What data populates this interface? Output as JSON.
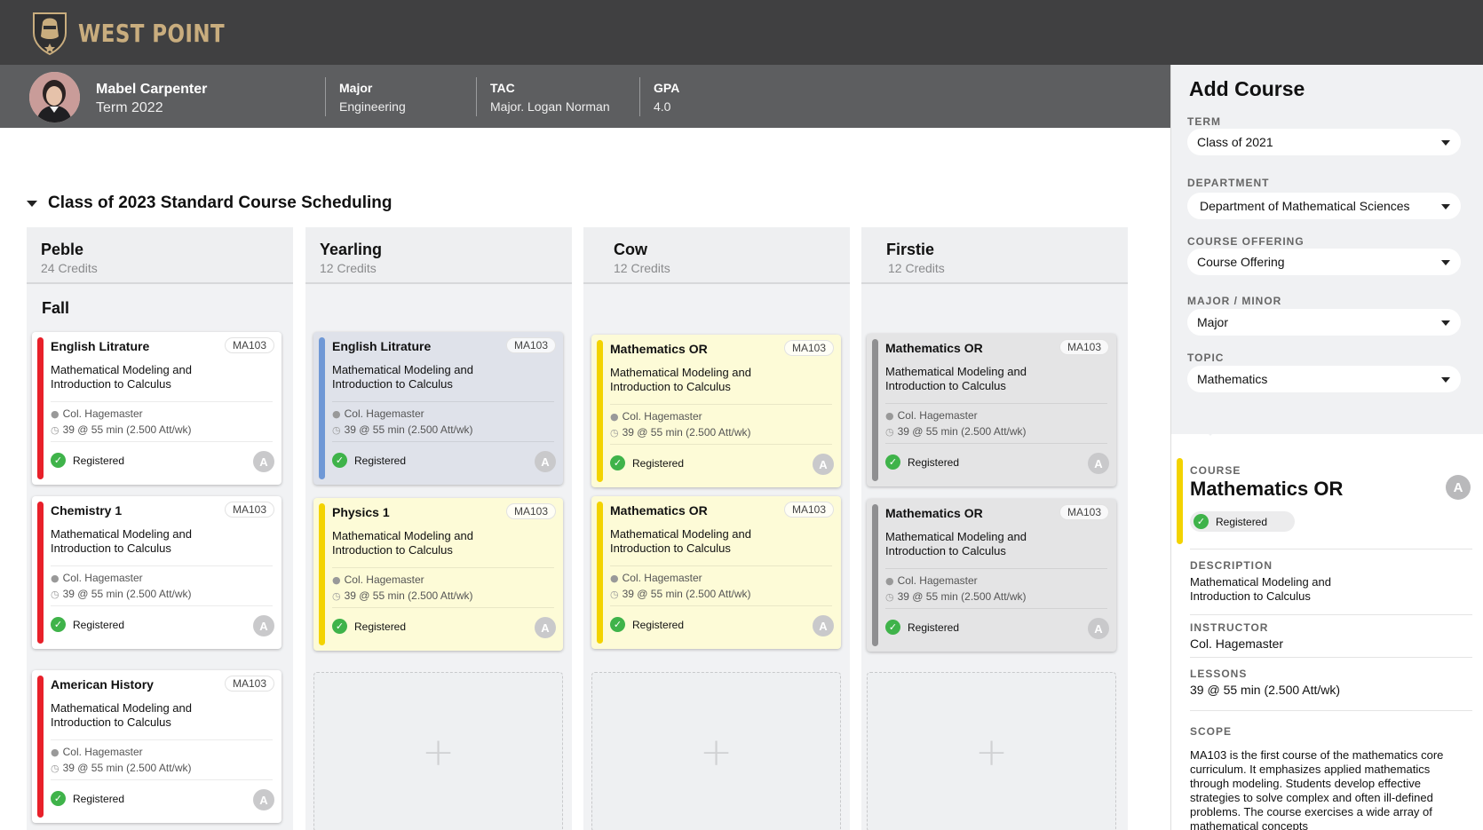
{
  "brand": {
    "name": "WEST POINT",
    "logo_icon": "knight-helmet-shield-icon"
  },
  "profile": {
    "name": "Mabel Carpenter",
    "term": "Term 2022",
    "major_label": "Major",
    "major_value": "Engineering",
    "tac_label": "TAC",
    "tac_value": "Major. Logan Norman",
    "gpa_label": "GPA",
    "gpa_value": "4.0"
  },
  "section": {
    "title": "Class of 2023 Standard Course Scheduling",
    "fall_label": "Fall"
  },
  "columns": [
    {
      "title": "Peble",
      "credits": "24 Credits"
    },
    {
      "title": "Yearling",
      "credits": "12 Credits"
    },
    {
      "title": "Cow",
      "credits": "12 Credits"
    },
    {
      "title": "Firstie",
      "credits": "12 Credits"
    }
  ],
  "cards": [
    {
      "title": "English Litrature",
      "code": "MA103",
      "description": "Mathematical Modeling and Introduction to Calculus",
      "instructor": "Col. Hagemaster",
      "lessons": "39 @ 55 min (2.500 Att/wk)",
      "status": "Registered",
      "grade": "A",
      "accent": "#e8202a",
      "bg": "#ffffff"
    },
    {
      "title": "Chemistry 1",
      "code": "MA103",
      "description": "Mathematical Modeling and Introduction to Calculus",
      "instructor": "Col. Hagemaster",
      "lessons": "39 @ 55 min (2.500 Att/wk)",
      "status": "Registered",
      "grade": "A",
      "accent": "#e8202a",
      "bg": "#ffffff"
    },
    {
      "title": "American History",
      "code": "MA103",
      "description": "Mathematical Modeling and Introduction to Calculus",
      "instructor": "Col. Hagemaster",
      "lessons": "39 @ 55 min (2.500 Att/wk)",
      "status": "Registered",
      "grade": "A",
      "accent": "#e8202a",
      "bg": "#ffffff"
    },
    {
      "title": "English Litrature",
      "code": "MA103",
      "description": "Mathematical Modeling and Introduction to Calculus",
      "instructor": "Col. Hagemaster",
      "lessons": "39 @ 55 min (2.500 Att/wk)",
      "status": "Registered",
      "grade": "A",
      "accent": "#6f98d6",
      "bg": "#dfe2ea"
    },
    {
      "title": "Physics 1",
      "code": "MA103",
      "description": "Mathematical Modeling and Introduction to Calculus",
      "instructor": "Col. Hagemaster",
      "lessons": "39 @ 55 min (2.500 Att/wk)",
      "status": "Registered",
      "grade": "A",
      "accent": "#f3d300",
      "bg": "#fdfbd7"
    },
    {
      "title": "Mathematics OR",
      "code": "MA103",
      "description": "Mathematical Modeling and Introduction to Calculus",
      "instructor": "Col. Hagemaster",
      "lessons": "39 @ 55 min (2.500 Att/wk)",
      "status": "Registered",
      "grade": "A",
      "accent": "#f3d300",
      "bg": "#fdfbd7"
    },
    {
      "title": "Mathematics OR",
      "code": "MA103",
      "description": "Mathematical Modeling and Introduction to Calculus",
      "instructor": "Col. Hagemaster",
      "lessons": "39 @ 55 min (2.500 Att/wk)",
      "status": "Registered",
      "grade": "A",
      "accent": "#f3d300",
      "bg": "#fdfbd7"
    },
    {
      "title": "Mathematics OR",
      "code": "MA103",
      "description": "Mathematical Modeling and Introduction to Calculus",
      "instructor": "Col. Hagemaster",
      "lessons": "39 @ 55 min (2.500 Att/wk)",
      "status": "Registered",
      "grade": "A",
      "accent": "#8f8f91",
      "bg": "#e4e4e5"
    },
    {
      "title": "Mathematics OR",
      "code": "MA103",
      "description": "Mathematical Modeling and Introduction to Calculus",
      "instructor": "Col. Hagemaster",
      "lessons": "39 @ 55 min (2.500 Att/wk)",
      "status": "Registered",
      "grade": "A",
      "accent": "#8f8f91",
      "bg": "#e4e4e5"
    }
  ],
  "empty_slot_symbol": "+",
  "add_course": {
    "title": "Add Course",
    "fields": [
      {
        "label": "TERM",
        "value": "Class of 2021"
      },
      {
        "label": "DEPARTMENT",
        "value": "Department of Mathematical Sciences"
      },
      {
        "label": "COURSE OFFERING",
        "value": "Course Offering"
      },
      {
        "label": "MAJOR / MINOR",
        "value": "Major"
      },
      {
        "label": "TOPIC",
        "value": "Mathematics"
      }
    ]
  },
  "detail": {
    "course_label": "COURSE",
    "course_name": "Mathematics OR",
    "status": "Registered",
    "grade": "A",
    "accent": "#f3d300",
    "description_label": "DESCRIPTION",
    "description": "Mathematical Modeling and Introduction to Calculus",
    "instructor_label": "INSTRUCTOR",
    "instructor": "Col. Hagemaster",
    "lessons_label": "LESSONS",
    "lessons": "39 @ 55 min (2.500 Att/wk)",
    "scope_label": "SCOPE",
    "scope": "MA103 is the first course of the mathematics core curriculum. It emphasizes applied mathematics through modeling. Students develop effective strategies to solve complex and often ill-defined problems. The course exercises a wide array of mathematical concepts"
  },
  "check_glyph": "✓"
}
